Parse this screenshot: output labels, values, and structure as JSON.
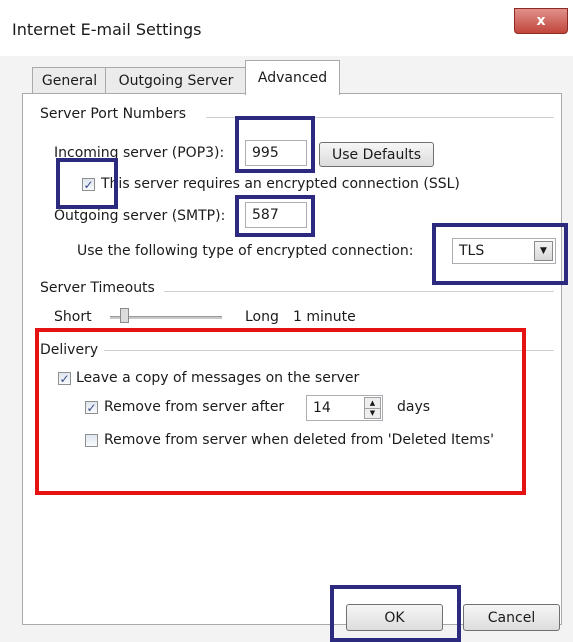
{
  "window": {
    "title": "Internet E-mail Settings",
    "close_glyph": "x"
  },
  "tabs": [
    {
      "label": "General"
    },
    {
      "label": "Outgoing Server"
    },
    {
      "label": "Advanced"
    }
  ],
  "ports": {
    "group_label": "Server Port Numbers",
    "incoming_label": "Incoming server (POP3):",
    "incoming_value": "995",
    "use_defaults_label": "Use Defaults",
    "ssl_label": "This server requires an encrypted connection (SSL)",
    "ssl_checked": true,
    "outgoing_label": "Outgoing server (SMTP):",
    "outgoing_value": "587",
    "encryption_label": "Use the following type of encrypted connection:",
    "encryption_value": "TLS"
  },
  "timeouts": {
    "group_label": "Server Timeouts",
    "short_label": "Short",
    "long_label": "Long",
    "timeout_value": "1 minute"
  },
  "delivery": {
    "group_label": "Delivery",
    "leave_copy_label": "Leave a copy of messages on the server",
    "leave_copy_checked": true,
    "remove_after_label": "Remove from server after",
    "remove_after_checked": true,
    "remove_after_days": "14",
    "days_label": "days",
    "remove_deleted_label": "Remove from server when deleted from 'Deleted Items'",
    "remove_deleted_checked": false
  },
  "buttons": {
    "ok_label": "OK",
    "cancel_label": "Cancel"
  },
  "icons": {
    "check": "✓",
    "dropdown": "▼",
    "spin_up": "▲",
    "spin_down": "▼"
  },
  "colors": {
    "annotation_navy": "#2b2a7f",
    "annotation_red": "#e41212"
  }
}
